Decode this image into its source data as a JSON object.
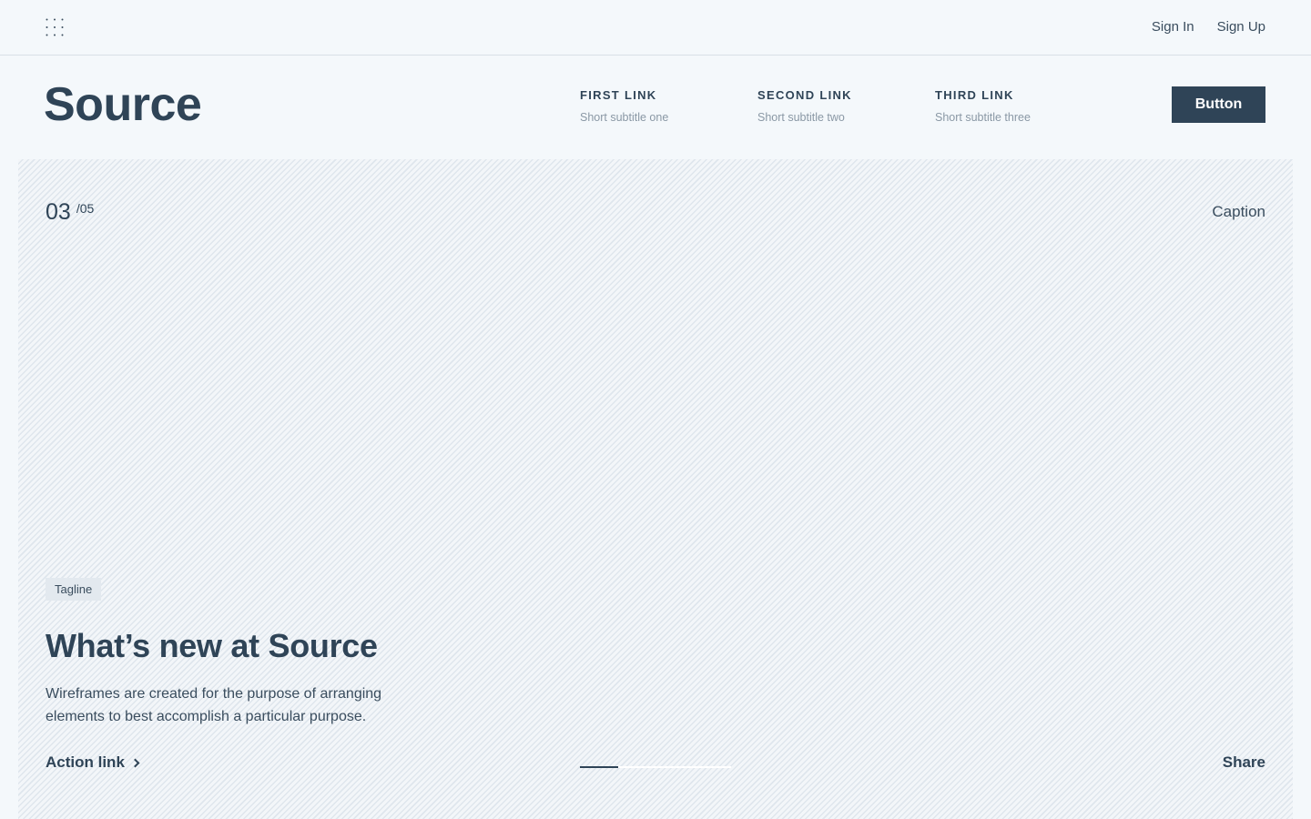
{
  "topbar": {
    "menu_icon": "grid-dots-icon",
    "sign_in": "Sign In",
    "sign_up": "Sign Up"
  },
  "header": {
    "brand": "Source",
    "nav": [
      {
        "title": "FIRST LINK",
        "subtitle": "Short subtitle one"
      },
      {
        "title": "SECOND LINK",
        "subtitle": "Short subtitle two"
      },
      {
        "title": "THIRD LINK",
        "subtitle": "Short subtitle three"
      }
    ],
    "button_label": "Button"
  },
  "hero": {
    "slide_current": "03",
    "slide_total": "/05",
    "caption": "Caption",
    "tagline": "Tagline",
    "title": "What’s new at Source",
    "body": "Wireframes are created for the purpose of arranging elements to best accomplish a particular purpose.",
    "action_link": "Action link",
    "progress_fraction": 0.25,
    "share": "Share"
  },
  "colors": {
    "primary": "#2f4457",
    "background": "#f4f8fb",
    "muted_text": "#8a98a5"
  }
}
